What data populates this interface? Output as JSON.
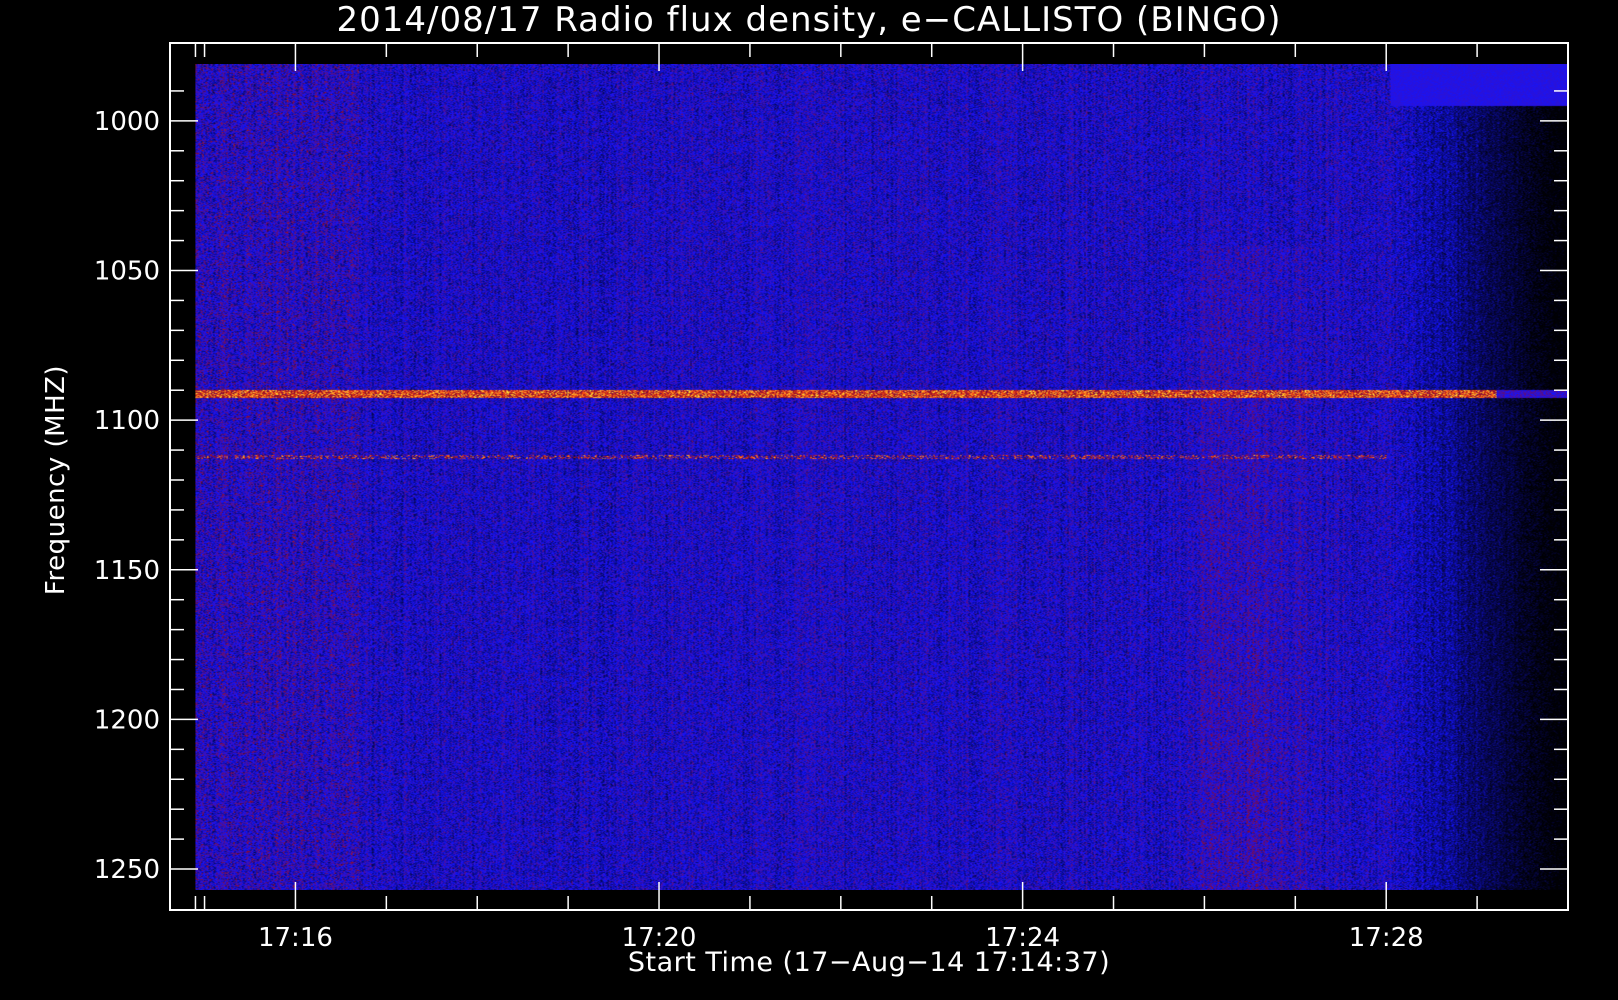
{
  "chart_data": {
    "type": "heatmap",
    "title": "2014/08/17  Radio flux density, e−CALLISTO (BINGO)",
    "xlabel": "Start Time (17−Aug−14 17:14:37)",
    "ylabel": "Frequency (MHZ)",
    "x_ticks": [
      "17:16",
      "17:20",
      "17:24",
      "17:28"
    ],
    "x_tick_minutes": [
      16,
      20,
      24,
      28
    ],
    "x_range_minutes": [
      14.62,
      30.0
    ],
    "data_range_minutes": [
      14.9,
      30.0
    ],
    "y_ticks": [
      1000,
      1050,
      1100,
      1150,
      1200,
      1250
    ],
    "ylim": [
      981,
      1257
    ],
    "y_axis_inverted": true,
    "colormap": [
      "#000000",
      "#0000ff",
      "#8b0000",
      "#ff4500",
      "#ffff00"
    ],
    "features": {
      "interference_band_mhz": 1091,
      "faint_band_mhz": 1112,
      "red_emission_minutes": [
        25.6,
        27.4
      ],
      "dark_fade_start_minutes": 28.0
    },
    "grid": false,
    "legend": "none"
  }
}
